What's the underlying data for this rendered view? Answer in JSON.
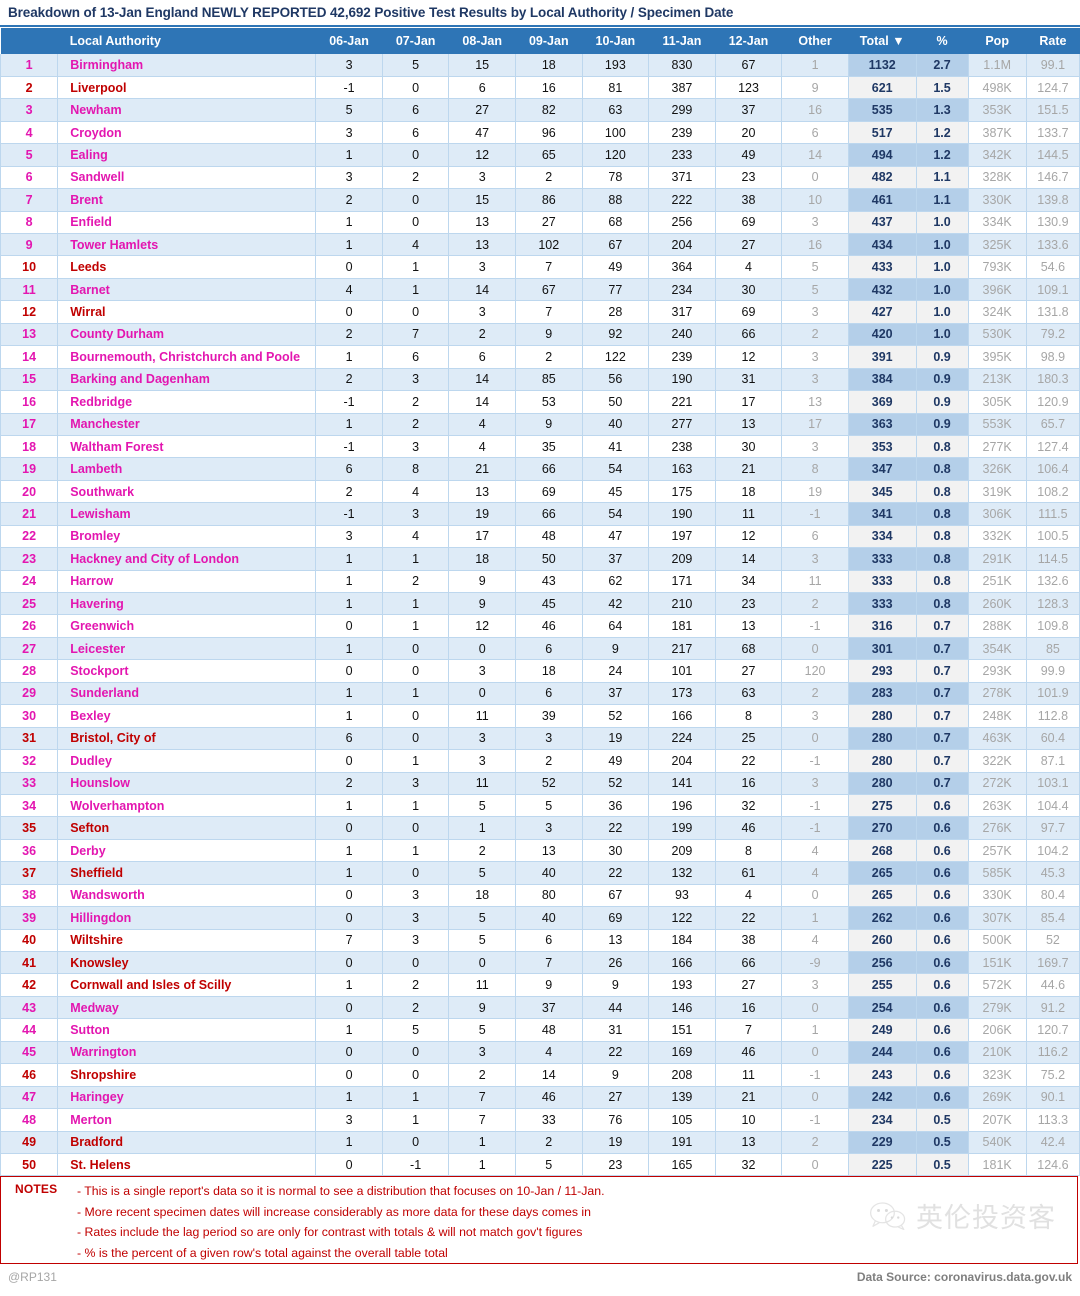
{
  "title": "Breakdown of 13-Jan England NEWLY REPORTED 42,692 Positive Test Results by Local Authority / Specimen Date",
  "table": {
    "headers": {
      "rank": "",
      "authority": "Local Authority",
      "d06": "06-Jan",
      "d07": "07-Jan",
      "d08": "08-Jan",
      "d09": "09-Jan",
      "d10": "10-Jan",
      "d11": "11-Jan",
      "d12": "12-Jan",
      "other": "Other",
      "total": "Total ▼",
      "pct": "%",
      "pop": "Pop",
      "rate": "Rate"
    },
    "sort_indicator": "▼",
    "rows": [
      {
        "rank": "1",
        "name": "Birmingham",
        "london": true,
        "d06": "3",
        "d07": "5",
        "d08": "15",
        "d09": "18",
        "d10": "193",
        "d11": "830",
        "d12": "67",
        "other": "1",
        "total": "1132",
        "pct": "2.7",
        "pop": "1.1M",
        "rate": "99.1"
      },
      {
        "rank": "2",
        "name": "Liverpool",
        "london": false,
        "d06": "-1",
        "d07": "0",
        "d08": "6",
        "d09": "16",
        "d10": "81",
        "d11": "387",
        "d12": "123",
        "other": "9",
        "total": "621",
        "pct": "1.5",
        "pop": "498K",
        "rate": "124.7"
      },
      {
        "rank": "3",
        "name": "Newham",
        "london": true,
        "d06": "5",
        "d07": "6",
        "d08": "27",
        "d09": "82",
        "d10": "63",
        "d11": "299",
        "d12": "37",
        "other": "16",
        "total": "535",
        "pct": "1.3",
        "pop": "353K",
        "rate": "151.5"
      },
      {
        "rank": "4",
        "name": "Croydon",
        "london": true,
        "d06": "3",
        "d07": "6",
        "d08": "47",
        "d09": "96",
        "d10": "100",
        "d11": "239",
        "d12": "20",
        "other": "6",
        "total": "517",
        "pct": "1.2",
        "pop": "387K",
        "rate": "133.7"
      },
      {
        "rank": "5",
        "name": "Ealing",
        "london": true,
        "d06": "1",
        "d07": "0",
        "d08": "12",
        "d09": "65",
        "d10": "120",
        "d11": "233",
        "d12": "49",
        "other": "14",
        "total": "494",
        "pct": "1.2",
        "pop": "342K",
        "rate": "144.5"
      },
      {
        "rank": "6",
        "name": "Sandwell",
        "london": true,
        "d06": "3",
        "d07": "2",
        "d08": "3",
        "d09": "2",
        "d10": "78",
        "d11": "371",
        "d12": "23",
        "other": "0",
        "total": "482",
        "pct": "1.1",
        "pop": "328K",
        "rate": "146.7"
      },
      {
        "rank": "7",
        "name": "Brent",
        "london": true,
        "d06": "2",
        "d07": "0",
        "d08": "15",
        "d09": "86",
        "d10": "88",
        "d11": "222",
        "d12": "38",
        "other": "10",
        "total": "461",
        "pct": "1.1",
        "pop": "330K",
        "rate": "139.8"
      },
      {
        "rank": "8",
        "name": "Enfield",
        "london": true,
        "d06": "1",
        "d07": "0",
        "d08": "13",
        "d09": "27",
        "d10": "68",
        "d11": "256",
        "d12": "69",
        "other": "3",
        "total": "437",
        "pct": "1.0",
        "pop": "334K",
        "rate": "130.9"
      },
      {
        "rank": "9",
        "name": "Tower Hamlets",
        "london": true,
        "d06": "1",
        "d07": "4",
        "d08": "13",
        "d09": "102",
        "d10": "67",
        "d11": "204",
        "d12": "27",
        "other": "16",
        "total": "434",
        "pct": "1.0",
        "pop": "325K",
        "rate": "133.6"
      },
      {
        "rank": "10",
        "name": "Leeds",
        "london": false,
        "d06": "0",
        "d07": "1",
        "d08": "3",
        "d09": "7",
        "d10": "49",
        "d11": "364",
        "d12": "4",
        "other": "5",
        "total": "433",
        "pct": "1.0",
        "pop": "793K",
        "rate": "54.6"
      },
      {
        "rank": "11",
        "name": "Barnet",
        "london": true,
        "d06": "4",
        "d07": "1",
        "d08": "14",
        "d09": "67",
        "d10": "77",
        "d11": "234",
        "d12": "30",
        "other": "5",
        "total": "432",
        "pct": "1.0",
        "pop": "396K",
        "rate": "109.1"
      },
      {
        "rank": "12",
        "name": "Wirral",
        "london": false,
        "d06": "0",
        "d07": "0",
        "d08": "3",
        "d09": "7",
        "d10": "28",
        "d11": "317",
        "d12": "69",
        "other": "3",
        "total": "427",
        "pct": "1.0",
        "pop": "324K",
        "rate": "131.8"
      },
      {
        "rank": "13",
        "name": "County Durham",
        "london": true,
        "d06": "2",
        "d07": "7",
        "d08": "2",
        "d09": "9",
        "d10": "92",
        "d11": "240",
        "d12": "66",
        "other": "2",
        "total": "420",
        "pct": "1.0",
        "pop": "530K",
        "rate": "79.2"
      },
      {
        "rank": "14",
        "name": "Bournemouth, Christchurch and Poole",
        "london": true,
        "d06": "1",
        "d07": "6",
        "d08": "6",
        "d09": "2",
        "d10": "122",
        "d11": "239",
        "d12": "12",
        "other": "3",
        "total": "391",
        "pct": "0.9",
        "pop": "395K",
        "rate": "98.9"
      },
      {
        "rank": "15",
        "name": "Barking and Dagenham",
        "london": true,
        "d06": "2",
        "d07": "3",
        "d08": "14",
        "d09": "85",
        "d10": "56",
        "d11": "190",
        "d12": "31",
        "other": "3",
        "total": "384",
        "pct": "0.9",
        "pop": "213K",
        "rate": "180.3"
      },
      {
        "rank": "16",
        "name": "Redbridge",
        "london": true,
        "d06": "-1",
        "d07": "2",
        "d08": "14",
        "d09": "53",
        "d10": "50",
        "d11": "221",
        "d12": "17",
        "other": "13",
        "total": "369",
        "pct": "0.9",
        "pop": "305K",
        "rate": "120.9"
      },
      {
        "rank": "17",
        "name": "Manchester",
        "london": true,
        "d06": "1",
        "d07": "2",
        "d08": "4",
        "d09": "9",
        "d10": "40",
        "d11": "277",
        "d12": "13",
        "other": "17",
        "total": "363",
        "pct": "0.9",
        "pop": "553K",
        "rate": "65.7"
      },
      {
        "rank": "18",
        "name": "Waltham Forest",
        "london": true,
        "d06": "-1",
        "d07": "3",
        "d08": "4",
        "d09": "35",
        "d10": "41",
        "d11": "238",
        "d12": "30",
        "other": "3",
        "total": "353",
        "pct": "0.8",
        "pop": "277K",
        "rate": "127.4"
      },
      {
        "rank": "19",
        "name": "Lambeth",
        "london": true,
        "d06": "6",
        "d07": "8",
        "d08": "21",
        "d09": "66",
        "d10": "54",
        "d11": "163",
        "d12": "21",
        "other": "8",
        "total": "347",
        "pct": "0.8",
        "pop": "326K",
        "rate": "106.4"
      },
      {
        "rank": "20",
        "name": "Southwark",
        "london": true,
        "d06": "2",
        "d07": "4",
        "d08": "13",
        "d09": "69",
        "d10": "45",
        "d11": "175",
        "d12": "18",
        "other": "19",
        "total": "345",
        "pct": "0.8",
        "pop": "319K",
        "rate": "108.2"
      },
      {
        "rank": "21",
        "name": "Lewisham",
        "london": true,
        "d06": "-1",
        "d07": "3",
        "d08": "19",
        "d09": "66",
        "d10": "54",
        "d11": "190",
        "d12": "11",
        "other": "-1",
        "total": "341",
        "pct": "0.8",
        "pop": "306K",
        "rate": "111.5"
      },
      {
        "rank": "22",
        "name": "Bromley",
        "london": true,
        "d06": "3",
        "d07": "4",
        "d08": "17",
        "d09": "48",
        "d10": "47",
        "d11": "197",
        "d12": "12",
        "other": "6",
        "total": "334",
        "pct": "0.8",
        "pop": "332K",
        "rate": "100.5"
      },
      {
        "rank": "23",
        "name": "Hackney and City of London",
        "london": true,
        "d06": "1",
        "d07": "1",
        "d08": "18",
        "d09": "50",
        "d10": "37",
        "d11": "209",
        "d12": "14",
        "other": "3",
        "total": "333",
        "pct": "0.8",
        "pop": "291K",
        "rate": "114.5"
      },
      {
        "rank": "24",
        "name": "Harrow",
        "london": true,
        "d06": "1",
        "d07": "2",
        "d08": "9",
        "d09": "43",
        "d10": "62",
        "d11": "171",
        "d12": "34",
        "other": "11",
        "total": "333",
        "pct": "0.8",
        "pop": "251K",
        "rate": "132.6"
      },
      {
        "rank": "25",
        "name": "Havering",
        "london": true,
        "d06": "1",
        "d07": "1",
        "d08": "9",
        "d09": "45",
        "d10": "42",
        "d11": "210",
        "d12": "23",
        "other": "2",
        "total": "333",
        "pct": "0.8",
        "pop": "260K",
        "rate": "128.3"
      },
      {
        "rank": "26",
        "name": "Greenwich",
        "london": true,
        "d06": "0",
        "d07": "1",
        "d08": "12",
        "d09": "46",
        "d10": "64",
        "d11": "181",
        "d12": "13",
        "other": "-1",
        "total": "316",
        "pct": "0.7",
        "pop": "288K",
        "rate": "109.8"
      },
      {
        "rank": "27",
        "name": "Leicester",
        "london": true,
        "d06": "1",
        "d07": "0",
        "d08": "0",
        "d09": "6",
        "d10": "9",
        "d11": "217",
        "d12": "68",
        "other": "0",
        "total": "301",
        "pct": "0.7",
        "pop": "354K",
        "rate": "85"
      },
      {
        "rank": "28",
        "name": "Stockport",
        "london": true,
        "d06": "0",
        "d07": "0",
        "d08": "3",
        "d09": "18",
        "d10": "24",
        "d11": "101",
        "d12": "27",
        "other": "120",
        "total": "293",
        "pct": "0.7",
        "pop": "293K",
        "rate": "99.9"
      },
      {
        "rank": "29",
        "name": "Sunderland",
        "london": true,
        "d06": "1",
        "d07": "1",
        "d08": "0",
        "d09": "6",
        "d10": "37",
        "d11": "173",
        "d12": "63",
        "other": "2",
        "total": "283",
        "pct": "0.7",
        "pop": "278K",
        "rate": "101.9"
      },
      {
        "rank": "30",
        "name": "Bexley",
        "london": true,
        "d06": "1",
        "d07": "0",
        "d08": "11",
        "d09": "39",
        "d10": "52",
        "d11": "166",
        "d12": "8",
        "other": "3",
        "total": "280",
        "pct": "0.7",
        "pop": "248K",
        "rate": "112.8"
      },
      {
        "rank": "31",
        "name": "Bristol, City of",
        "london": false,
        "d06": "6",
        "d07": "0",
        "d08": "3",
        "d09": "3",
        "d10": "19",
        "d11": "224",
        "d12": "25",
        "other": "0",
        "total": "280",
        "pct": "0.7",
        "pop": "463K",
        "rate": "60.4"
      },
      {
        "rank": "32",
        "name": "Dudley",
        "london": true,
        "d06": "0",
        "d07": "1",
        "d08": "3",
        "d09": "2",
        "d10": "49",
        "d11": "204",
        "d12": "22",
        "other": "-1",
        "total": "280",
        "pct": "0.7",
        "pop": "322K",
        "rate": "87.1"
      },
      {
        "rank": "33",
        "name": "Hounslow",
        "london": true,
        "d06": "2",
        "d07": "3",
        "d08": "11",
        "d09": "52",
        "d10": "52",
        "d11": "141",
        "d12": "16",
        "other": "3",
        "total": "280",
        "pct": "0.7",
        "pop": "272K",
        "rate": "103.1"
      },
      {
        "rank": "34",
        "name": "Wolverhampton",
        "london": true,
        "d06": "1",
        "d07": "1",
        "d08": "5",
        "d09": "5",
        "d10": "36",
        "d11": "196",
        "d12": "32",
        "other": "-1",
        "total": "275",
        "pct": "0.6",
        "pop": "263K",
        "rate": "104.4"
      },
      {
        "rank": "35",
        "name": "Sefton",
        "london": false,
        "d06": "0",
        "d07": "0",
        "d08": "1",
        "d09": "3",
        "d10": "22",
        "d11": "199",
        "d12": "46",
        "other": "-1",
        "total": "270",
        "pct": "0.6",
        "pop": "276K",
        "rate": "97.7"
      },
      {
        "rank": "36",
        "name": "Derby",
        "london": true,
        "d06": "1",
        "d07": "1",
        "d08": "2",
        "d09": "13",
        "d10": "30",
        "d11": "209",
        "d12": "8",
        "other": "4",
        "total": "268",
        "pct": "0.6",
        "pop": "257K",
        "rate": "104.2"
      },
      {
        "rank": "37",
        "name": "Sheffield",
        "london": false,
        "d06": "1",
        "d07": "0",
        "d08": "5",
        "d09": "40",
        "d10": "22",
        "d11": "132",
        "d12": "61",
        "other": "4",
        "total": "265",
        "pct": "0.6",
        "pop": "585K",
        "rate": "45.3"
      },
      {
        "rank": "38",
        "name": "Wandsworth",
        "london": true,
        "d06": "0",
        "d07": "3",
        "d08": "18",
        "d09": "80",
        "d10": "67",
        "d11": "93",
        "d12": "4",
        "other": "0",
        "total": "265",
        "pct": "0.6",
        "pop": "330K",
        "rate": "80.4"
      },
      {
        "rank": "39",
        "name": "Hillingdon",
        "london": true,
        "d06": "0",
        "d07": "3",
        "d08": "5",
        "d09": "40",
        "d10": "69",
        "d11": "122",
        "d12": "22",
        "other": "1",
        "total": "262",
        "pct": "0.6",
        "pop": "307K",
        "rate": "85.4"
      },
      {
        "rank": "40",
        "name": "Wiltshire",
        "london": false,
        "d06": "7",
        "d07": "3",
        "d08": "5",
        "d09": "6",
        "d10": "13",
        "d11": "184",
        "d12": "38",
        "other": "4",
        "total": "260",
        "pct": "0.6",
        "pop": "500K",
        "rate": "52"
      },
      {
        "rank": "41",
        "name": "Knowsley",
        "london": false,
        "d06": "0",
        "d07": "0",
        "d08": "0",
        "d09": "7",
        "d10": "26",
        "d11": "166",
        "d12": "66",
        "other": "-9",
        "total": "256",
        "pct": "0.6",
        "pop": "151K",
        "rate": "169.7"
      },
      {
        "rank": "42",
        "name": "Cornwall and Isles of Scilly",
        "london": false,
        "d06": "1",
        "d07": "2",
        "d08": "11",
        "d09": "9",
        "d10": "9",
        "d11": "193",
        "d12": "27",
        "other": "3",
        "total": "255",
        "pct": "0.6",
        "pop": "572K",
        "rate": "44.6"
      },
      {
        "rank": "43",
        "name": "Medway",
        "london": true,
        "d06": "0",
        "d07": "2",
        "d08": "9",
        "d09": "37",
        "d10": "44",
        "d11": "146",
        "d12": "16",
        "other": "0",
        "total": "254",
        "pct": "0.6",
        "pop": "279K",
        "rate": "91.2"
      },
      {
        "rank": "44",
        "name": "Sutton",
        "london": true,
        "d06": "1",
        "d07": "5",
        "d08": "5",
        "d09": "48",
        "d10": "31",
        "d11": "151",
        "d12": "7",
        "other": "1",
        "total": "249",
        "pct": "0.6",
        "pop": "206K",
        "rate": "120.7"
      },
      {
        "rank": "45",
        "name": "Warrington",
        "london": true,
        "d06": "0",
        "d07": "0",
        "d08": "3",
        "d09": "4",
        "d10": "22",
        "d11": "169",
        "d12": "46",
        "other": "0",
        "total": "244",
        "pct": "0.6",
        "pop": "210K",
        "rate": "116.2"
      },
      {
        "rank": "46",
        "name": "Shropshire",
        "london": false,
        "d06": "0",
        "d07": "0",
        "d08": "2",
        "d09": "14",
        "d10": "9",
        "d11": "208",
        "d12": "11",
        "other": "-1",
        "total": "243",
        "pct": "0.6",
        "pop": "323K",
        "rate": "75.2"
      },
      {
        "rank": "47",
        "name": "Haringey",
        "london": true,
        "d06": "1",
        "d07": "1",
        "d08": "7",
        "d09": "46",
        "d10": "27",
        "d11": "139",
        "d12": "21",
        "other": "0",
        "total": "242",
        "pct": "0.6",
        "pop": "269K",
        "rate": "90.1"
      },
      {
        "rank": "48",
        "name": "Merton",
        "london": true,
        "d06": "3",
        "d07": "1",
        "d08": "7",
        "d09": "33",
        "d10": "76",
        "d11": "105",
        "d12": "10",
        "other": "-1",
        "total": "234",
        "pct": "0.5",
        "pop": "207K",
        "rate": "113.3"
      },
      {
        "rank": "49",
        "name": "Bradford",
        "london": false,
        "d06": "1",
        "d07": "0",
        "d08": "1",
        "d09": "2",
        "d10": "19",
        "d11": "191",
        "d12": "13",
        "other": "2",
        "total": "229",
        "pct": "0.5",
        "pop": "540K",
        "rate": "42.4"
      },
      {
        "rank": "50",
        "name": "St. Helens",
        "london": false,
        "d06": "0",
        "d07": "-1",
        "d08": "1",
        "d09": "5",
        "d10": "23",
        "d11": "165",
        "d12": "32",
        "other": "0",
        "total": "225",
        "pct": "0.5",
        "pop": "181K",
        "rate": "124.6"
      }
    ]
  },
  "notes": {
    "label": "NOTES",
    "items": [
      "- This is a single report's data so it is normal to see a distribution that focuses on 10-Jan / 11-Jan.",
      "- More recent specimen dates will increase considerably as more data for these days comes in",
      "- Rates include the lag period so are only for contrast with totals & will not match gov't figures",
      "- % is the percent of a given row's total against the overall table total"
    ]
  },
  "footer": {
    "credit": "@RP131",
    "source": "Data Source: coronavirus.data.gov.uk"
  },
  "watermark": {
    "text": "英伦投资客",
    "icon": "wechat-icon"
  },
  "colors": {
    "header_blue": "#2E75B6",
    "row_alt": "#DEEBF7",
    "total_alt": "#B4CFE9",
    "total_plain": "#F2F2F2",
    "london_magenta": "#E316B0",
    "non_london_red": "#C00000",
    "muted_grey": "#A6A6A6",
    "title_navy": "#1F3864"
  }
}
